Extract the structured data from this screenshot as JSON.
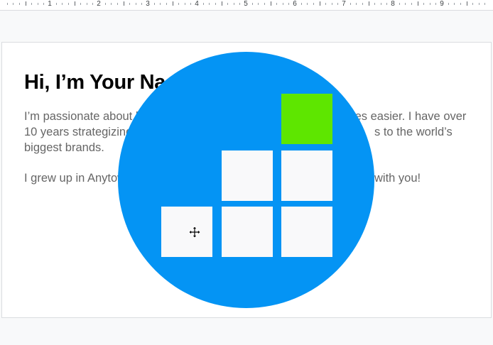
{
  "ruler": {
    "numbers": [
      "1",
      "2",
      "3",
      "4",
      "5",
      "6",
      "7",
      "8",
      "9"
    ]
  },
  "page": {
    "heading": "Hi, I’m Your Na",
    "paragraph1": "I’m passionate about lives easier. I have over 10 years strategizing to the world’s biggest brands.",
    "paragraph1_left": "I’m passionate about l",
    "paragraph1_right": "lives easier. I have over",
    "paragraph1_line2_left": "10 years strategizing",
    "paragraph1_line2_right": "s to the world’s",
    "paragraph1_line3": "biggest brands.",
    "paragraph2_left": "I grew up in Anytow",
    "paragraph2_right": "with you!"
  },
  "overlay": {
    "circle_color": "#0494f4",
    "tile_color": "#f9f9fa",
    "highlight_tile_color": "#5ee600",
    "cursor_icon": "move-icon"
  }
}
